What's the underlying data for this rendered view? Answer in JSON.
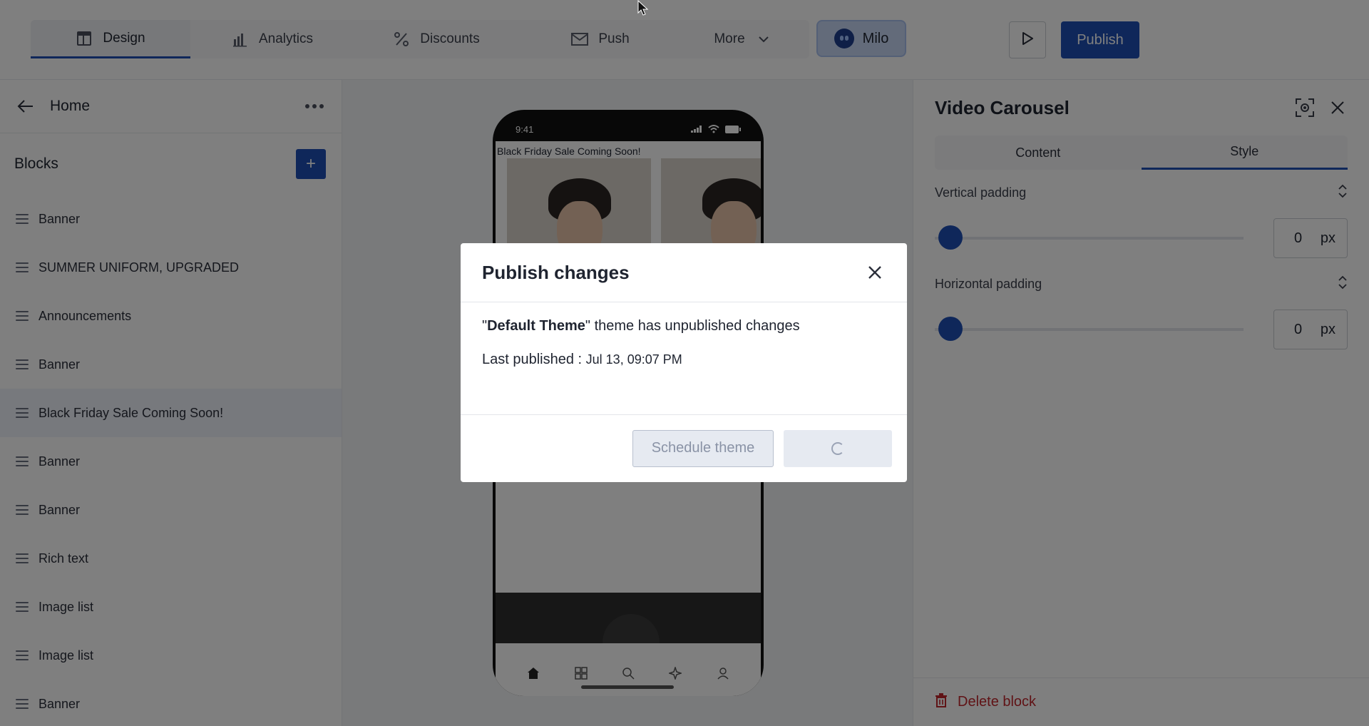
{
  "topbar": {
    "tabs": [
      {
        "label": "Design",
        "icon": "layout-icon"
      },
      {
        "label": "Analytics",
        "icon": "bar-chart-icon"
      },
      {
        "label": "Discounts",
        "icon": "percent-icon"
      },
      {
        "label": "Push",
        "icon": "mail-icon"
      },
      {
        "label": "More",
        "icon": "chevron-down-icon"
      }
    ],
    "milo_label": "Milo",
    "publish_label": "Publish"
  },
  "left_panel": {
    "breadcrumb": "Home",
    "blocks_heading": "Blocks",
    "add_label": "+",
    "blocks": [
      "Banner",
      "SUMMER UNIFORM, UPGRADED",
      "Announcements",
      "Banner",
      "Black Friday Sale Coming Soon!",
      "Banner",
      "Banner",
      "Rich text",
      "Image list",
      "Image list",
      "Banner"
    ],
    "selected_index": 4
  },
  "preview": {
    "status_time": "9:41",
    "heading": "Black Friday Sale Coming Soon!"
  },
  "right_panel": {
    "title": "Video Carousel",
    "tabs": [
      "Content",
      "Style"
    ],
    "active_tab": "Style",
    "vertical_padding": {
      "label": "Vertical padding",
      "value": "0",
      "unit": "px"
    },
    "horizontal_padding": {
      "label": "Horizontal padding",
      "value": "0",
      "unit": "px"
    },
    "delete_label": "Delete block"
  },
  "modal": {
    "title": "Publish changes",
    "theme_name": "Default Theme",
    "message_suffix": " theme has unpublished changes",
    "last_published_label": "Last published : ",
    "last_published_value": "Jul 13, 09:07 PM",
    "schedule_label": "Schedule theme"
  },
  "colors": {
    "accent": "#1e4fb4",
    "danger": "#c0262d",
    "overlay": "rgba(0,0,0,0.5)"
  }
}
